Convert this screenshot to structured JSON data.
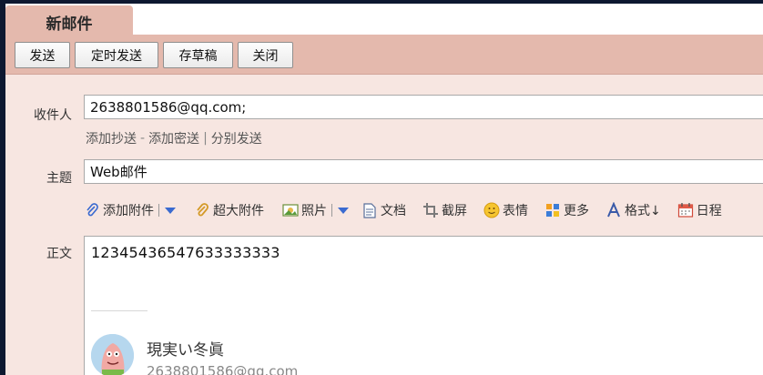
{
  "tab": {
    "title": "新邮件"
  },
  "toolbar": {
    "buttons": [
      {
        "label": "发送"
      },
      {
        "label": "定时发送"
      },
      {
        "label": "存草稿"
      },
      {
        "label": "关闭"
      }
    ]
  },
  "recipients": {
    "label": "收件人",
    "value": "2638801586@qq.com;",
    "links": [
      "添加抄送",
      "添加密送",
      "分别发送"
    ],
    "separators": [
      "-",
      "|"
    ]
  },
  "subject": {
    "label": "主题",
    "value": "Web邮件"
  },
  "editor_tools": [
    {
      "label": "添加附件",
      "icon": "paperclip-icon"
    },
    {
      "label": "超大附件",
      "icon": "large-paperclip-icon"
    },
    {
      "label": "照片",
      "icon": "photo-icon"
    },
    {
      "label": "文档",
      "icon": "document-icon"
    },
    {
      "label": "截屏",
      "icon": "screenshot-icon"
    },
    {
      "label": "表情",
      "icon": "emoji-icon"
    },
    {
      "label": "更多",
      "icon": "more-grid-icon"
    },
    {
      "label": "格式↓",
      "icon": "format-text-icon"
    },
    {
      "label": "日程",
      "icon": "calendar-icon"
    }
  ],
  "body": {
    "label": "正文",
    "text": "12345436547633333333",
    "signature": {
      "name": "現実い冬眞",
      "email": "2638801586@qq.com"
    }
  },
  "colors": {
    "header": "#e4b9ad",
    "panel": "#f7e6e1",
    "accent": "#3a6ad0"
  }
}
